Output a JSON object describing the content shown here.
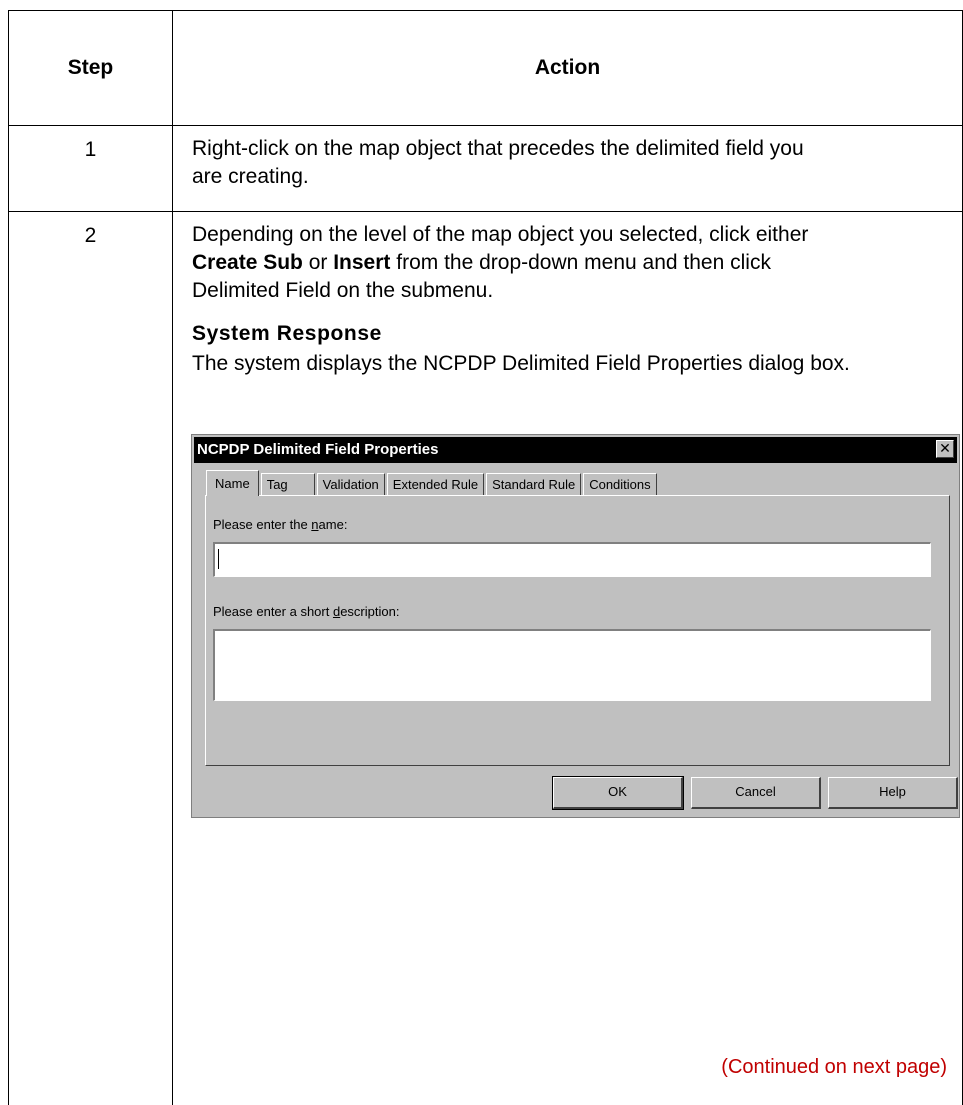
{
  "table": {
    "header_step": "Step",
    "header_action": "Action",
    "rows": [
      {
        "step": "1",
        "action_line1": "Right-click on the map object that precedes the delimited field you",
        "action_line2": "are creating."
      },
      {
        "step": "2",
        "action_pre": "Depending on the level of the map object you selected, click either",
        "action_bold1": "Create Sub",
        "action_or": " or ",
        "action_bold2": "Insert",
        "action_post": " from the drop-down menu and then click",
        "action_line3": "Delimited Field on the submenu.",
        "system_response_title": "System Response",
        "system_response_text": "The system displays the NCPDP Delimited Field Properties dialog box."
      }
    ],
    "continued_note": "(Continued on next page)"
  },
  "dialog": {
    "title": "NCPDP Delimited Field Properties",
    "close_glyph": "✕",
    "tabs": [
      "Name",
      "Tag",
      "Validation",
      "Extended Rule",
      "Standard Rule",
      "Conditions"
    ],
    "active_tab": "Name",
    "name_label_pre": "Please enter the ",
    "name_label_mnemonic": "n",
    "name_label_post": "ame:",
    "name_value": "",
    "desc_label_pre": "Please enter a short ",
    "desc_label_mnemonic": "d",
    "desc_label_post": "escription:",
    "desc_value": "",
    "buttons": {
      "ok": "OK",
      "cancel": "Cancel",
      "help": "Help"
    }
  }
}
